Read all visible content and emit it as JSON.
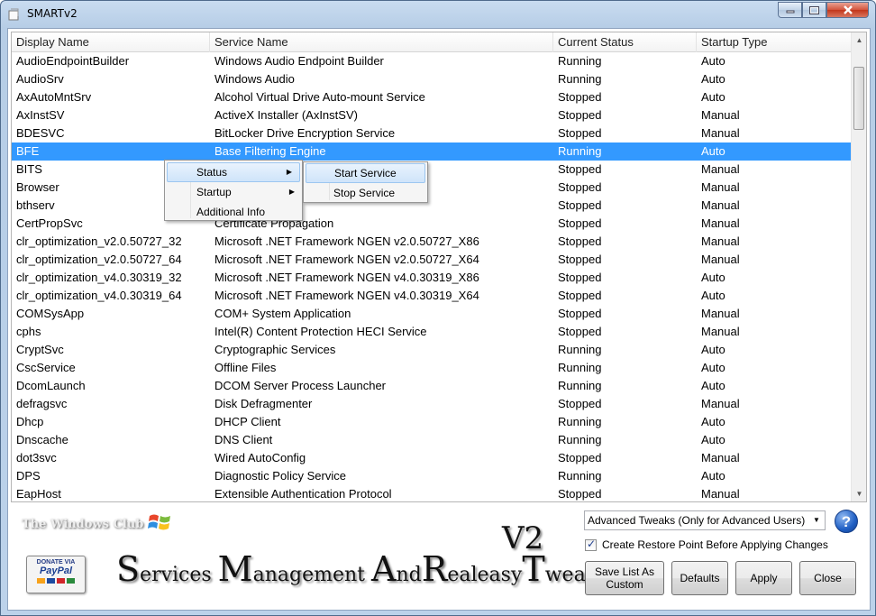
{
  "window": {
    "title": "SMARTv2"
  },
  "columns": [
    "Display Name",
    "Service Name",
    "Current Status",
    "Startup Type"
  ],
  "rows": [
    [
      "AudioEndpointBuilder",
      "Windows Audio Endpoint Builder",
      "Running",
      "Auto"
    ],
    [
      "AudioSrv",
      "Windows Audio",
      "Running",
      "Auto"
    ],
    [
      "AxAutoMntSrv",
      "Alcohol Virtual Drive Auto-mount Service",
      "Stopped",
      "Auto"
    ],
    [
      "AxInstSV",
      "ActiveX Installer (AxInstSV)",
      "Stopped",
      "Manual"
    ],
    [
      "BDESVC",
      "BitLocker Drive Encryption Service",
      "Stopped",
      "Manual"
    ],
    [
      "BFE",
      "Base Filtering Engine",
      "Running",
      "Auto"
    ],
    [
      "BITS",
      "",
      "Stopped",
      "Manual"
    ],
    [
      "Browser",
      "",
      "Stopped",
      "Manual"
    ],
    [
      "bthserv",
      "rt Service",
      "Stopped",
      "Manual"
    ],
    [
      "CertPropSvc",
      "Certificate Propagation",
      "Stopped",
      "Manual"
    ],
    [
      "clr_optimization_v2.0.50727_32",
      "Microsoft .NET Framework NGEN v2.0.50727_X86",
      "Stopped",
      "Manual"
    ],
    [
      "clr_optimization_v2.0.50727_64",
      "Microsoft .NET Framework NGEN v2.0.50727_X64",
      "Stopped",
      "Manual"
    ],
    [
      "clr_optimization_v4.0.30319_32",
      "Microsoft .NET Framework NGEN v4.0.30319_X86",
      "Stopped",
      "Auto"
    ],
    [
      "clr_optimization_v4.0.30319_64",
      "Microsoft .NET Framework NGEN v4.0.30319_X64",
      "Stopped",
      "Auto"
    ],
    [
      "COMSysApp",
      "COM+ System Application",
      "Stopped",
      "Manual"
    ],
    [
      "cphs",
      "Intel(R) Content Protection HECI Service",
      "Stopped",
      "Manual"
    ],
    [
      "CryptSvc",
      "Cryptographic Services",
      "Running",
      "Auto"
    ],
    [
      "CscService",
      "Offline Files",
      "Running",
      "Auto"
    ],
    [
      "DcomLaunch",
      "DCOM Server Process Launcher",
      "Running",
      "Auto"
    ],
    [
      "defragsvc",
      "Disk Defragmenter",
      "Stopped",
      "Manual"
    ],
    [
      "Dhcp",
      "DHCP Client",
      "Running",
      "Auto"
    ],
    [
      "Dnscache",
      "DNS Client",
      "Running",
      "Auto"
    ],
    [
      "dot3svc",
      "Wired AutoConfig",
      "Stopped",
      "Manual"
    ],
    [
      "DPS",
      "Diagnostic Policy Service",
      "Running",
      "Auto"
    ],
    [
      "EapHost",
      "Extensible Authentication Protocol",
      "Stopped",
      "Manual"
    ]
  ],
  "selected_row": 5,
  "context_menu": {
    "items": [
      "Status",
      "Startup",
      "Additional Info"
    ],
    "submenu": [
      "Start Service",
      "Stop Service"
    ]
  },
  "banner": {
    "text": "The Windows Club"
  },
  "paypal": {
    "line1": "DONATE VIA",
    "line2": "PayPal"
  },
  "logo": {
    "S": "S",
    "ervices": "ervices ",
    "M": "M",
    "anagement": "anagement ",
    "A": "A",
    "nd": "nd",
    "R": "R",
    "ealeasy": "ealeasy",
    "T": "T",
    "weaking": "weaking",
    "version": "V2"
  },
  "mode_select": {
    "value": "Advanced Tweaks (Only for Advanced Users)"
  },
  "restore_point": {
    "label": "Create Restore Point Before Applying Changes",
    "checked": true
  },
  "buttons": {
    "save_line1": "Save List As",
    "save_line2": "Custom",
    "defaults": "Defaults",
    "apply": "Apply",
    "close": "Close"
  },
  "colors": {
    "selection": "#3399ff",
    "paypal_blue": "#1a3e91"
  },
  "icons": [
    "app-icon",
    "minimize-icon",
    "maximize-icon",
    "close-icon",
    "windows-flag-icon",
    "help-icon",
    "submenu-arrow-icon",
    "dropdown-arrow-icon",
    "checkmark-icon"
  ]
}
